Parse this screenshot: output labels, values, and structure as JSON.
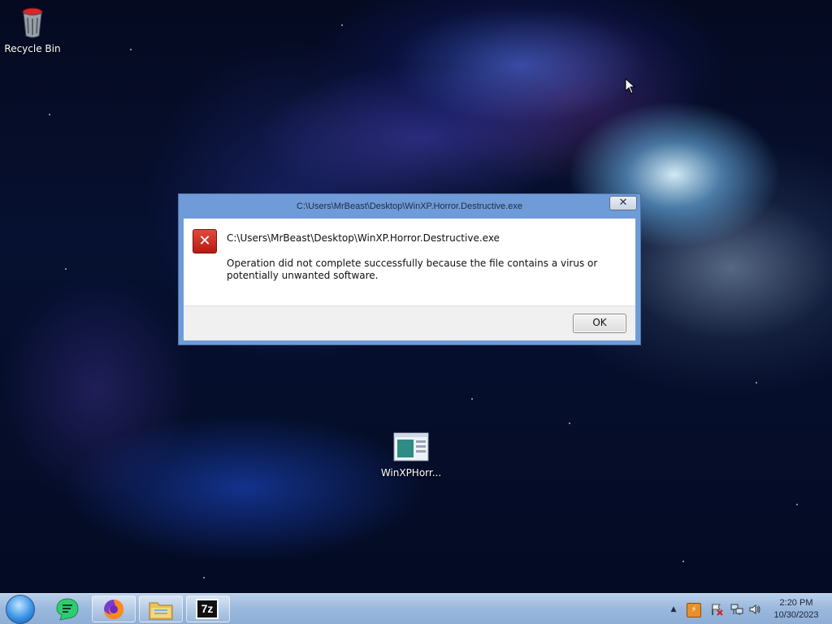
{
  "desktop": {
    "icons": [
      {
        "label": "Recycle Bin",
        "icon": "recycle-bin-icon"
      },
      {
        "label": "WinXPHorr...",
        "icon": "exe-file-icon"
      }
    ]
  },
  "dialog": {
    "title": "C:\\Users\\MrBeast\\Desktop\\WinXP.Horror.Destructive.exe",
    "close_label": "✕",
    "heading": "C:\\Users\\MrBeast\\Desktop\\WinXP.Horror.Destructive.exe",
    "message": "Operation did not complete successfully because the file contains a virus or potentially unwanted software.",
    "icon": "error-icon",
    "ok_label": "OK"
  },
  "taskbar": {
    "pinned": [
      {
        "name": "start-orb"
      },
      {
        "name": "chat-app-icon"
      },
      {
        "name": "firefox-icon"
      },
      {
        "name": "file-explorer-icon"
      },
      {
        "name": "7zip-icon",
        "label": "7z"
      }
    ],
    "tray": {
      "time": "2:20 PM",
      "date": "10/30/2023"
    }
  }
}
